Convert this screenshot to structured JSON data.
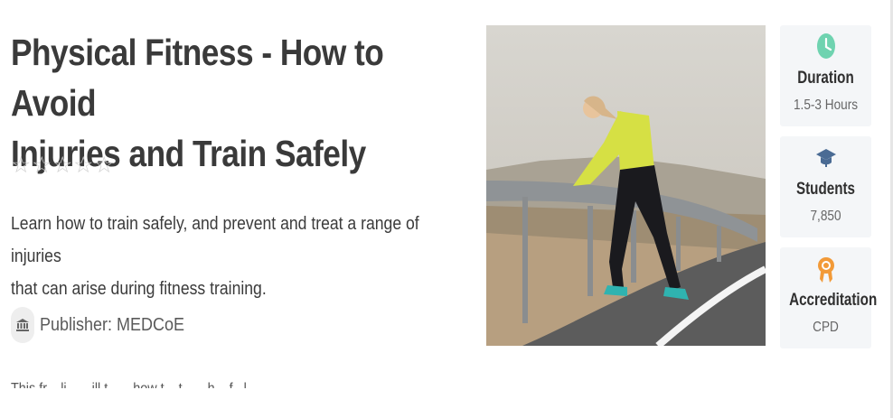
{
  "course": {
    "title_line1": "Physical Fitness - How to Avoid",
    "title_line2": "Injuries and Train Safely",
    "rating_stars": [
      "☆",
      "☆",
      "☆",
      "☆",
      "☆"
    ],
    "rating_value": 0,
    "description_line1": "Learn how to train safely, and prevent and treat a range of injuries",
    "description_line2": "that can arise during fitness training.",
    "publisher": "Publisher: MEDCoE",
    "body_preview": "This fr... li...      ...ill t... ...how t... t... ...h... f...l ..."
  },
  "info_cards": [
    {
      "icon": "clock-icon",
      "label": "Duration",
      "value": "1.5-3 Hours",
      "color": "#6fd3b0"
    },
    {
      "icon": "graduation-cap-icon",
      "label": "Students",
      "value": "7,850",
      "color": "#4a6b94"
    },
    {
      "icon": "award-ribbon-icon",
      "label": "Accreditation",
      "value": "CPD",
      "color": "#f29a38"
    }
  ]
}
